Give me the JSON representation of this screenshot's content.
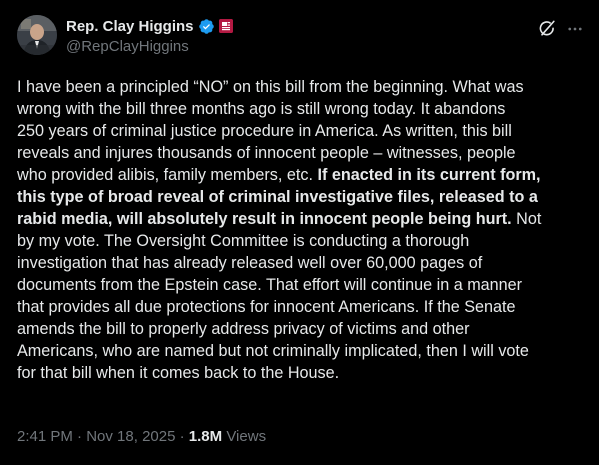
{
  "author": {
    "display_name": "Rep. Clay Higgins",
    "handle": "@RepClayHiggins",
    "badges": [
      "verified-badge-icon",
      "us-government-affiliation-icon"
    ],
    "colors": {
      "verified": "#1d9bf0",
      "affiliation": "#b31942"
    }
  },
  "actions": {
    "grok_icon": "grok-icon",
    "more_icon": "more-options-icon"
  },
  "post": {
    "lines": [
      {
        "segments": [
          {
            "text": "I have been a principled “NO” on this bill from the beginning. What was",
            "bold": false
          }
        ]
      },
      {
        "segments": [
          {
            "text": "wrong with the bill three months ago is still wrong today. It abandons",
            "bold": false
          }
        ]
      },
      {
        "segments": [
          {
            "text": "250 years of criminal justice procedure in America. As written, this bill",
            "bold": false
          }
        ]
      },
      {
        "segments": [
          {
            "text": "reveals and injures thousands of innocent people – witnesses, people",
            "bold": false
          }
        ]
      },
      {
        "segments": [
          {
            "text": "who provided alibis, family members, etc. ",
            "bold": false
          },
          {
            "text": "If enacted in its current form,",
            "bold": true
          }
        ]
      },
      {
        "segments": [
          {
            "text": "this type of broad reveal of criminal investigative files, released to a",
            "bold": true
          }
        ]
      },
      {
        "segments": [
          {
            "text": "rabid media, will absolutely result in innocent people being hurt.",
            "bold": true
          },
          {
            "text": " Not",
            "bold": false
          }
        ]
      },
      {
        "segments": [
          {
            "text": "by my vote. The Oversight Committee is conducting a thorough",
            "bold": false
          }
        ]
      },
      {
        "segments": [
          {
            "text": "investigation that has already released well over 60,000 pages of",
            "bold": false
          }
        ]
      },
      {
        "segments": [
          {
            "text": "documents from the Epstein case. That effort will continue in a manner",
            "bold": false
          }
        ]
      },
      {
        "segments": [
          {
            "text": "that provides all due protections for innocent Americans. If the Senate",
            "bold": false
          }
        ]
      },
      {
        "segments": [
          {
            "text": "amends the bill to properly address privacy of victims and other",
            "bold": false
          }
        ]
      },
      {
        "segments": [
          {
            "text": "Americans, who are named but not criminally implicated, then I will vote",
            "bold": false
          }
        ]
      },
      {
        "segments": [
          {
            "text": "for that bill when it comes back to the House.",
            "bold": false
          }
        ]
      }
    ]
  },
  "meta": {
    "time": "2:41 PM",
    "separator": " · ",
    "date": "Nov 18, 2025",
    "separator2": " · ",
    "views_count": "1.8M",
    "views_label": " Views"
  }
}
